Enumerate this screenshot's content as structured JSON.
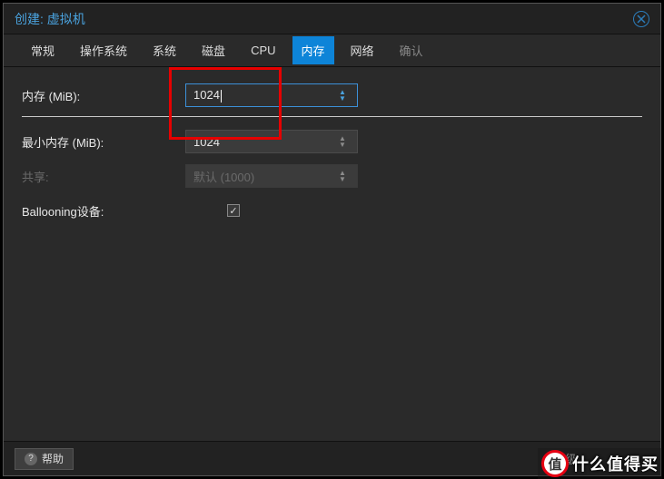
{
  "title": "创建: 虚拟机",
  "tabs": {
    "general": "常规",
    "os": "操作系统",
    "system": "系统",
    "disk": "磁盘",
    "cpu": "CPU",
    "memory": "内存",
    "network": "网络",
    "confirm": "确认"
  },
  "form": {
    "memory_label": "内存 (MiB):",
    "memory_value": "1024",
    "min_memory_label": "最小内存 (MiB):",
    "min_memory_value": "1024",
    "shares_label": "共享:",
    "shares_value": "默认 (1000)",
    "ballooning_label": "Ballooning设备:",
    "ballooning_check": "✓"
  },
  "footer": {
    "help": "帮助",
    "advanced": "高级"
  },
  "watermark": {
    "logo": "值",
    "text": "什么值得买"
  }
}
